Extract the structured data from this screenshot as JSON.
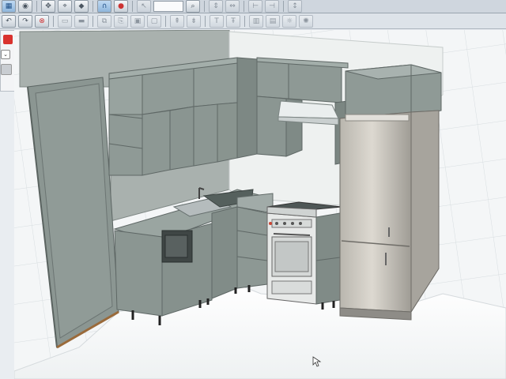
{
  "toolbar": {
    "row1_icons": [
      "grid-icon",
      "eye-icon",
      "move-icon",
      "snap-icon",
      "rotate-icon",
      "magnet-icon",
      "record-icon",
      "zoom-field",
      "zoom-icon",
      "align-icon",
      "align-icon-2",
      "dimension-icon",
      "dimension-icon-2",
      "measure-icon"
    ],
    "row2_icons": [
      "undo-icon",
      "redo-icon",
      "stop-icon",
      "layer-icon",
      "layer-icon-2",
      "copy-icon",
      "paste-icon",
      "group-icon",
      "ungroup-icon",
      "arrange-icon",
      "arrange-icon-2",
      "text-icon",
      "text-icon-2",
      "cabinet-icon",
      "cabinet-icon-2",
      "light-icon",
      "light-icon-2"
    ]
  },
  "viewport": {
    "content": "3D kitchen cabinet design render",
    "accent_colors": {
      "cabinet": "#8d9895",
      "cabinet_dark": "#6f7a78",
      "fridge": "#c9c6bf",
      "floor": "#ffffff",
      "wall": "#a9b1ae"
    }
  }
}
